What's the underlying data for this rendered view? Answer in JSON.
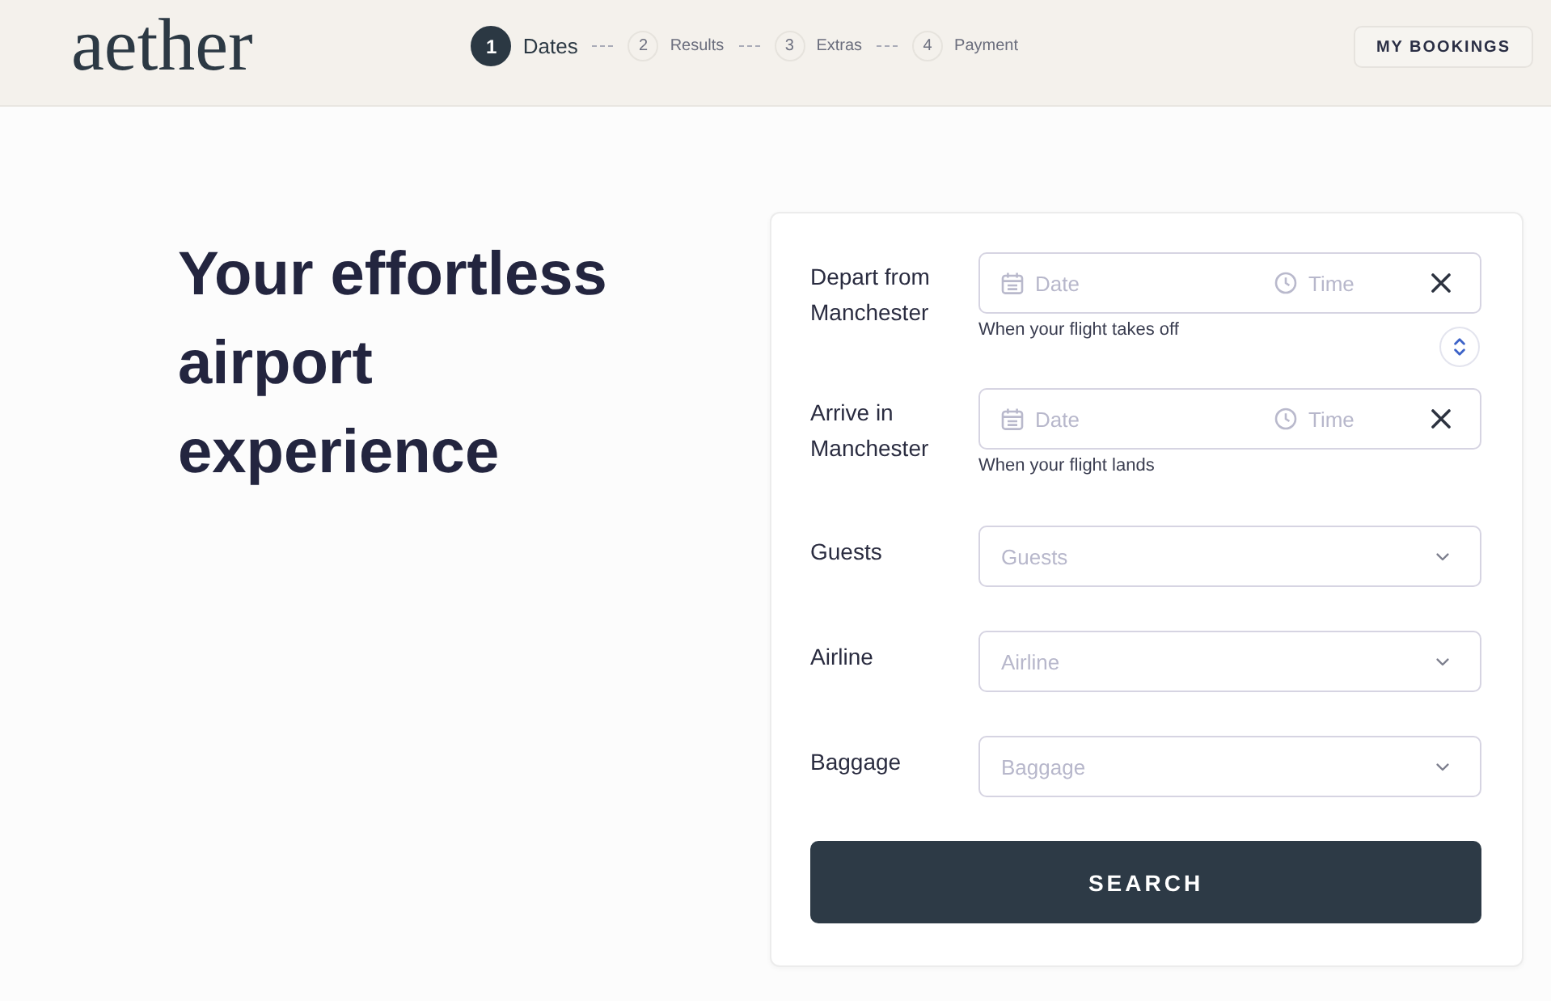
{
  "header": {
    "logo": "aether",
    "steps": [
      {
        "number": "1",
        "label": "Dates",
        "selected": true
      },
      {
        "number": "2",
        "label": "Results",
        "selected": false
      },
      {
        "number": "3",
        "label": "Extras",
        "selected": false
      },
      {
        "number": "4",
        "label": "Payment",
        "selected": false
      }
    ],
    "my_bookings_button": "MY BOOKINGS"
  },
  "hero": {
    "heading": "Your effortless airport experience"
  },
  "booking_form": {
    "rows": [
      {
        "kind": "datetime",
        "label": "Depart from Manchester",
        "date_placeholder": "Date",
        "time_placeholder": "Time",
        "hint": "When your flight takes off"
      },
      {
        "kind": "datetime",
        "label": "Arrive in Manchester",
        "date_placeholder": "Date",
        "time_placeholder": "Time",
        "hint": "When your flight lands"
      },
      {
        "kind": "select",
        "label": "Guests",
        "placeholder": "Guests"
      },
      {
        "kind": "select",
        "label": "Airline",
        "placeholder": "Airline"
      },
      {
        "kind": "select",
        "label": "Baggage",
        "placeholder": "Baggage"
      }
    ],
    "search_button": "SEARCH"
  }
}
